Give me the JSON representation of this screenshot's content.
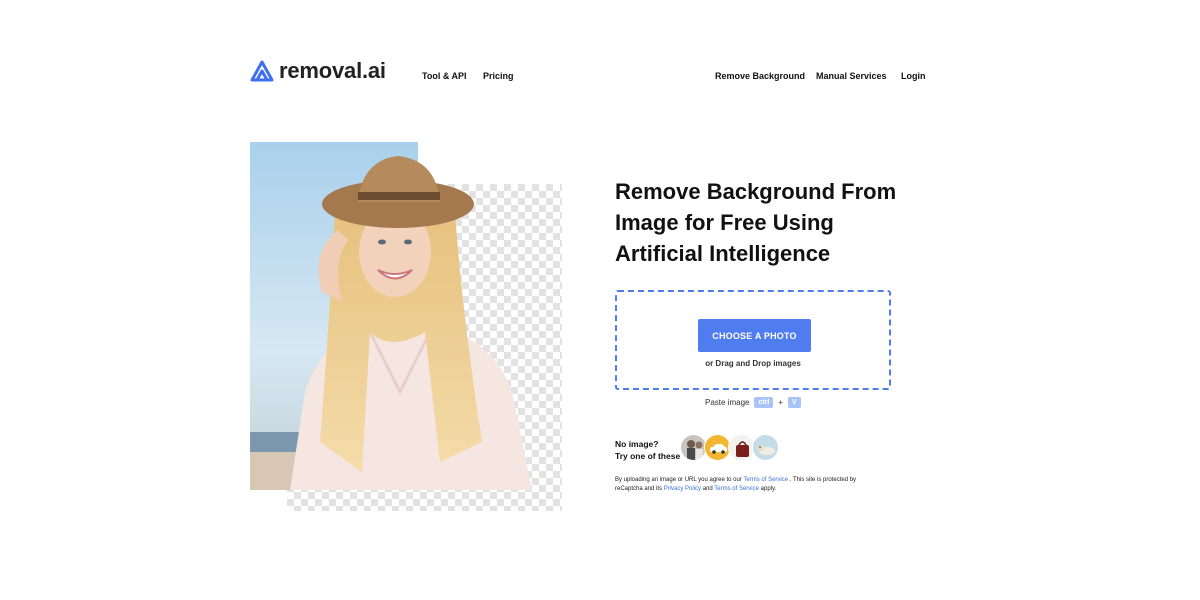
{
  "header": {
    "logo_text": "removal.ai",
    "nav_left": [
      "Tool & API",
      "Pricing"
    ],
    "nav_right": [
      "Remove Background",
      "Manual Services",
      "Login"
    ]
  },
  "hero": {
    "headline_lines": [
      "Remove Background From",
      "Image for Free Using",
      "Artificial Intelligence"
    ]
  },
  "upload": {
    "button_label": "CHOOSE A PHOTO",
    "drag_text": "or Drag and Drop images"
  },
  "paste": {
    "label": "Paste image",
    "key1": "ctrl",
    "plus": "+",
    "key2": "V"
  },
  "samples": {
    "line1": "No image?",
    "line2": "Try one of these",
    "items": [
      "sample-people-icon",
      "sample-car-icon",
      "sample-bag-icon",
      "sample-dog-icon"
    ]
  },
  "legal": {
    "text1": "By uploading an image or URL you agree to our",
    "terms1": "Terms of Service",
    "text2": ". This site is protected by reCaptcha and its",
    "privacy": "Privacy Policy",
    "text3": "and",
    "terms2": "Terms of Service",
    "text4": "apply."
  },
  "colors": {
    "accent": "#4f7df0",
    "link": "#3a6fd8",
    "key_bg": "#a9c3f7"
  }
}
